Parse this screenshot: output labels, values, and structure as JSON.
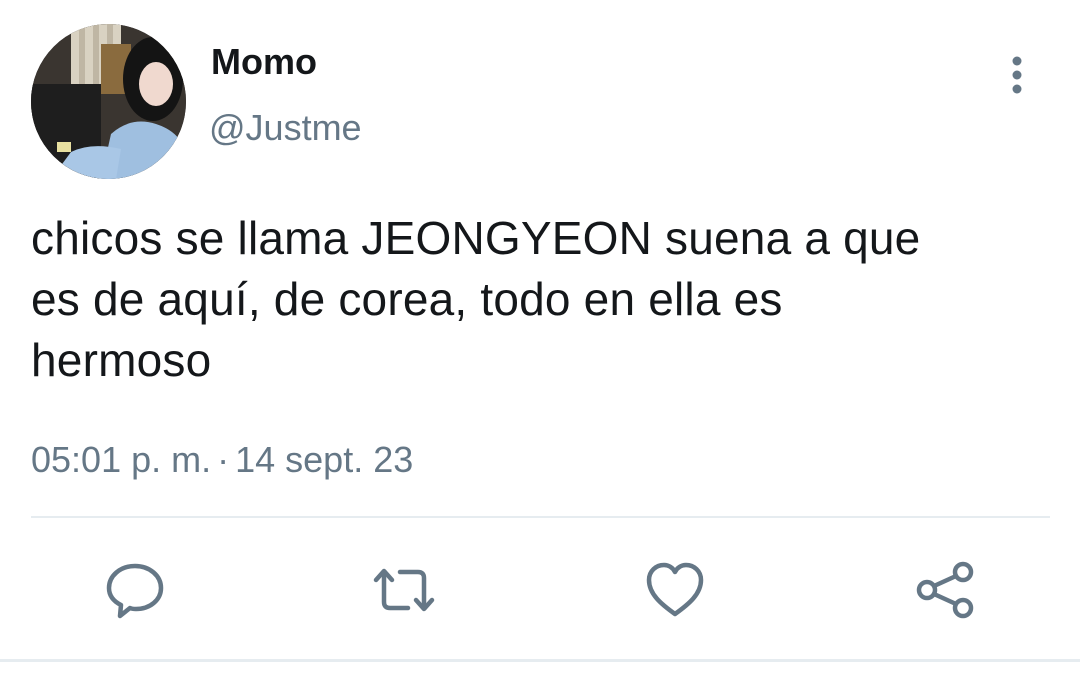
{
  "user": {
    "display_name": "Momo",
    "handle": "@Justme",
    "avatar_icon": "profile-photo"
  },
  "tweet": {
    "text_lines": [
      "chicos se llama JEONGYEON suena a que",
      "es de aquí, de corea, todo en ella es",
      "hermoso"
    ],
    "time": "05:01 p. m.",
    "separator": "·",
    "date": "14 sept. 23"
  },
  "actions": [
    {
      "icon": "reply-icon"
    },
    {
      "icon": "retweet-icon"
    },
    {
      "icon": "like-icon"
    },
    {
      "icon": "share-icon"
    }
  ],
  "colors": {
    "text": "#14171a",
    "secondary": "#657786",
    "divider": "#e6ecf0"
  }
}
